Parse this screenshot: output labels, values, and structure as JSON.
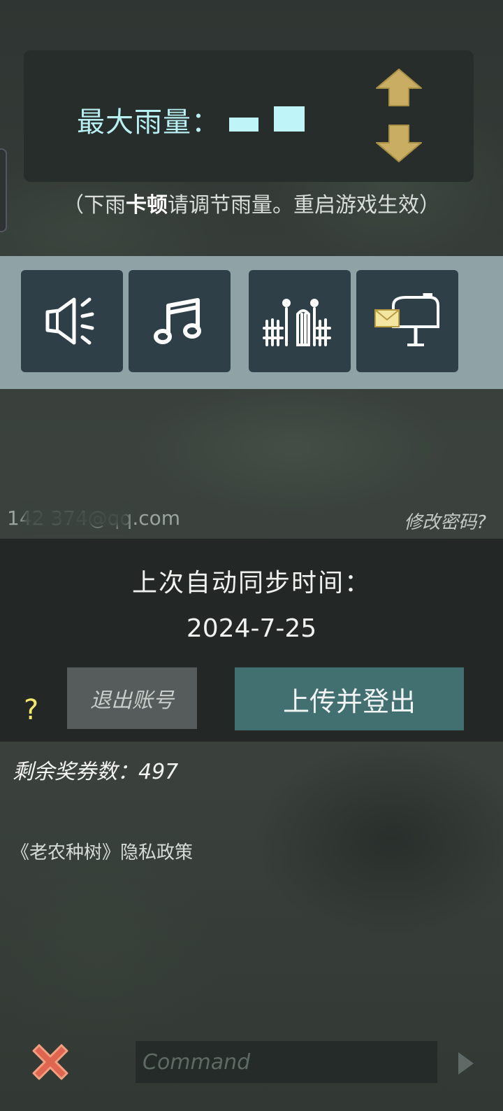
{
  "rain": {
    "label": "最大雨量：",
    "hint_prefix": "（下雨",
    "hint_bold": "卡顿",
    "hint_suffix": "请调节雨量。重启游戏生效）"
  },
  "icons": [
    "speaker-icon",
    "music-note-icon",
    "fence-gate-icon",
    "mailbox-icon"
  ],
  "account": {
    "email": "142 374@qq.com",
    "change_password": "修改密码?"
  },
  "sync": {
    "label": "上次自动同步时间：",
    "date": "2024-7-25",
    "help": "?",
    "logout": "退出账号",
    "upload_logout": "上传并登出"
  },
  "tickets": {
    "label": "剩余奖券数：497"
  },
  "privacy": "《老农种树》隐私政策",
  "command": {
    "placeholder": "Command"
  },
  "colors": {
    "rain_accent": "#bff4f8",
    "arrow_gold": "#c8ad62",
    "strip_bg": "#8fa3a6",
    "icon_tile": "#2f3f48",
    "upload_button": "#427071",
    "close_red": "#e06650",
    "help_yellow": "#f2e86a"
  }
}
